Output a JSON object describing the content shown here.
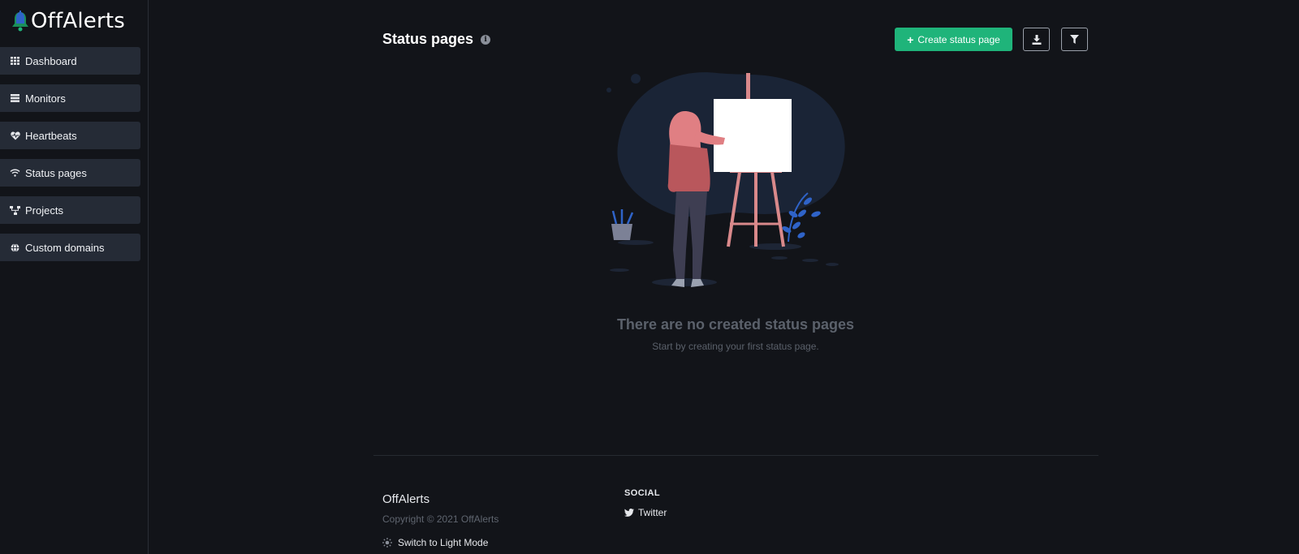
{
  "app": {
    "logo_text": "OffAlerts"
  },
  "sidebar": {
    "items": [
      {
        "label": "Dashboard",
        "icon": "grid-icon"
      },
      {
        "label": "Monitors",
        "icon": "list-icon"
      },
      {
        "label": "Heartbeats",
        "icon": "heartbeat-icon"
      },
      {
        "label": "Status pages",
        "icon": "wifi-icon"
      },
      {
        "label": "Projects",
        "icon": "sitemap-icon"
      },
      {
        "label": "Custom domains",
        "icon": "globe-icon"
      }
    ]
  },
  "header": {
    "title": "Status pages",
    "create_button_label": "Create status page"
  },
  "empty_state": {
    "title": "There are no created status pages",
    "subtitle": "Start by creating your first status page."
  },
  "footer": {
    "brand": "OffAlerts",
    "copyright": "Copyright © 2021 OffAlerts",
    "mode_toggle_label": "Switch to Light Mode",
    "social_heading": "SOCIAL",
    "twitter_label": "Twitter"
  },
  "colors": {
    "background": "#121419",
    "sidebar_item": "#252b36",
    "accent_green": "#1fb47a",
    "muted_text": "#5b616b"
  }
}
